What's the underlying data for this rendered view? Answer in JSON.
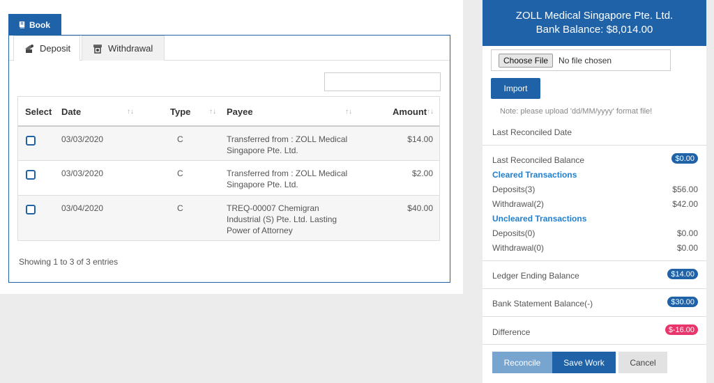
{
  "book_tab": {
    "label": "Book",
    "icon": "book-icon"
  },
  "sub_tabs": {
    "deposit": {
      "label": "Deposit",
      "icon": "deposit-icon"
    },
    "withdrawal": {
      "label": "Withdrawal",
      "icon": "withdrawal-icon"
    }
  },
  "table": {
    "headers": {
      "select": "Select",
      "date": "Date",
      "type": "Type",
      "payee": "Payee",
      "amount": "Amount"
    },
    "sort_glyph": "↑↓",
    "rows": [
      {
        "date": "03/03/2020",
        "type": "C",
        "payee_lines": [
          "Transferred from : ZOLL Medical",
          "Singapore Pte. Ltd."
        ],
        "amount": "$14.00"
      },
      {
        "date": "03/03/2020",
        "type": "C",
        "payee_lines": [
          "Transferred from : ZOLL Medical",
          "Singapore Pte. Ltd."
        ],
        "amount": "$2.00"
      },
      {
        "date": "03/04/2020",
        "type": "C",
        "payee_lines": [
          "TREQ-00007 Chemigran",
          "Industrial (S) Pte. Ltd. Lasting",
          "Power of Attorney"
        ],
        "amount": "$40.00"
      }
    ]
  },
  "showing_text": "Showing 1 to 3 of 3 entries",
  "right_panel": {
    "company": "ZOLL Medical Singapore Pte. Ltd.",
    "bank_balance": "Bank Balance: $8,014.00",
    "choose_file": "Choose File",
    "no_file": "No file chosen",
    "import": "Import",
    "note": "Note: please upload 'dd/MM/yyyy' format file!",
    "last_reconciled_date": "Last Reconciled Date",
    "last_reconciled_balance": {
      "label": "Last Reconciled Balance",
      "value": "$0.00"
    },
    "cleared_title": "Cleared Transactions",
    "cleared_deposits": {
      "label": "Deposits(3)",
      "value": "$56.00"
    },
    "cleared_withdrawal": {
      "label": "Withdrawal(2)",
      "value": "$42.00"
    },
    "uncleared_title": "Uncleared Transactions",
    "uncleared_deposits": {
      "label": "Deposits(0)",
      "value": "$0.00"
    },
    "uncleared_withdrawal": {
      "label": "Withdrawal(0)",
      "value": "$0.00"
    },
    "ledger_ending": {
      "label": "Ledger Ending Balance",
      "value": "$14.00"
    },
    "bank_statement": {
      "label": "Bank Statement Balance(-)",
      "value": "$30.00"
    },
    "difference": {
      "label": "Difference",
      "value": "$-16.00"
    },
    "buttons": {
      "reconcile": "Reconcile",
      "save": "Save Work",
      "cancel": "Cancel"
    }
  },
  "colors": {
    "primary": "#1f62a8",
    "danger": "#e8356b",
    "section": "#1f7fd1"
  }
}
